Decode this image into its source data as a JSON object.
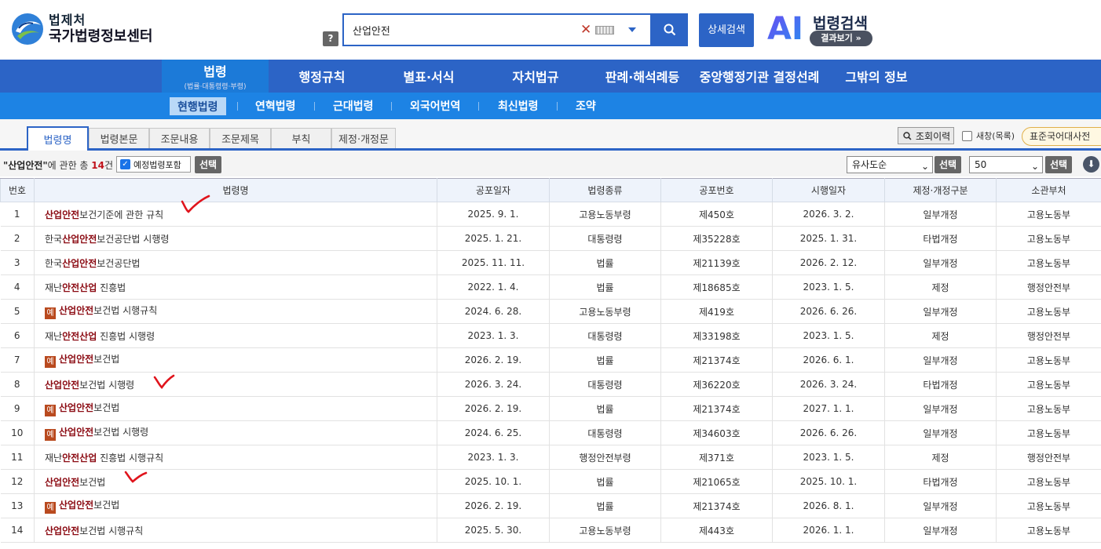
{
  "header": {
    "org": "법제처",
    "title": "국가법령정보센터",
    "help_label": "?",
    "search": {
      "value": "산업안전",
      "placeholder": ""
    },
    "advanced_search_label": "상세검색",
    "ai_label": "AI",
    "ai_title": "법령검색",
    "ai_result_label": "결과보기 »"
  },
  "nav_main": [
    {
      "label": "법령",
      "sub": "(법률·대통령령·부령)"
    },
    {
      "label": "행정규칙"
    },
    {
      "label": "별표·서식"
    },
    {
      "label": "자치법규"
    },
    {
      "label": "판례·해석례등"
    },
    {
      "label": "중앙행정기관 결정선례"
    },
    {
      "label": "그밖의 정보"
    }
  ],
  "nav_sub": [
    "현행법령",
    "연혁법령",
    "근대법령",
    "외국어번역",
    "최신법령",
    "조약"
  ],
  "tabs": [
    "법령명",
    "법령본문",
    "조문내용",
    "조문제목",
    "부칙",
    "제정·개정문"
  ],
  "tools": {
    "history_label": "조회이력",
    "new_window_label": "새창(목록)",
    "dictionary_label": "표준국어대사전"
  },
  "summary": {
    "query": "\"산업안전\"",
    "text_mid": "에 관한  총 ",
    "count": "14",
    "unit": "건",
    "include_label": "예정법령포함",
    "select_label": "선택",
    "sort_value": "유사도순",
    "page_size_value": "50"
  },
  "table": {
    "columns": [
      "번호",
      "법령명",
      "공포일자",
      "법령종류",
      "공포번호",
      "시행일자",
      "제정·개정구분",
      "소관부처"
    ],
    "rows": [
      {
        "no": "1",
        "badge": "",
        "pre": "",
        "kw": "산업안전",
        "post": "보건기준에 관한 규칙",
        "date": "2025. 9. 1.",
        "type": "고용노동부령",
        "pno": "제450호",
        "edate": "2026. 3. 2.",
        "rev": "일부개정",
        "dept": "고용노동부"
      },
      {
        "no": "2",
        "badge": "",
        "pre": "한국",
        "kw": "산업안전",
        "post": "보건공단법 시행령",
        "date": "2025. 1. 21.",
        "type": "대통령령",
        "pno": "제35228호",
        "edate": "2025. 1. 31.",
        "rev": "타법개정",
        "dept": "고용노동부"
      },
      {
        "no": "3",
        "badge": "",
        "pre": "한국",
        "kw": "산업안전",
        "post": "보건공단법",
        "date": "2025. 11. 11.",
        "type": "법률",
        "pno": "제21139호",
        "edate": "2026. 2. 12.",
        "rev": "일부개정",
        "dept": "고용노동부"
      },
      {
        "no": "4",
        "badge": "",
        "pre": "재난",
        "kw": "안전산업",
        "post": " 진흥법",
        "date": "2022. 1. 4.",
        "type": "법률",
        "pno": "제18685호",
        "edate": "2023. 1. 5.",
        "rev": "제정",
        "dept": "행정안전부"
      },
      {
        "no": "5",
        "badge": "예",
        "pre": "",
        "kw": "산업안전",
        "post": "보건법 시행규칙",
        "date": "2024. 6. 28.",
        "type": "고용노동부령",
        "pno": "제419호",
        "edate": "2026. 6. 26.",
        "rev": "일부개정",
        "dept": "고용노동부"
      },
      {
        "no": "6",
        "badge": "",
        "pre": "재난",
        "kw": "안전산업",
        "post": " 진흥법 시행령",
        "date": "2023. 1. 3.",
        "type": "대통령령",
        "pno": "제33198호",
        "edate": "2023. 1. 5.",
        "rev": "제정",
        "dept": "행정안전부"
      },
      {
        "no": "7",
        "badge": "예",
        "pre": "",
        "kw": "산업안전",
        "post": "보건법",
        "date": "2026. 2. 19.",
        "type": "법률",
        "pno": "제21374호",
        "edate": "2026. 6. 1.",
        "rev": "일부개정",
        "dept": "고용노동부"
      },
      {
        "no": "8",
        "badge": "",
        "pre": "",
        "kw": "산업안전",
        "post": "보건법 시행령",
        "date": "2026. 3. 24.",
        "type": "대통령령",
        "pno": "제36220호",
        "edate": "2026. 3. 24.",
        "rev": "타법개정",
        "dept": "고용노동부"
      },
      {
        "no": "9",
        "badge": "예",
        "pre": "",
        "kw": "산업안전",
        "post": "보건법",
        "date": "2026. 2. 19.",
        "type": "법률",
        "pno": "제21374호",
        "edate": "2027. 1. 1.",
        "rev": "일부개정",
        "dept": "고용노동부"
      },
      {
        "no": "10",
        "badge": "예",
        "pre": "",
        "kw": "산업안전",
        "post": "보건법 시행령",
        "date": "2024. 6. 25.",
        "type": "대통령령",
        "pno": "제34603호",
        "edate": "2026. 6. 26.",
        "rev": "일부개정",
        "dept": "고용노동부"
      },
      {
        "no": "11",
        "badge": "",
        "pre": "재난",
        "kw": "안전산업",
        "post": " 진흥법 시행규칙",
        "date": "2023. 1. 3.",
        "type": "행정안전부령",
        "pno": "제371호",
        "edate": "2023. 1. 5.",
        "rev": "제정",
        "dept": "행정안전부"
      },
      {
        "no": "12",
        "badge": "",
        "pre": "",
        "kw": "산업안전",
        "post": "보건법",
        "date": "2025. 10. 1.",
        "type": "법률",
        "pno": "제21065호",
        "edate": "2025. 10. 1.",
        "rev": "타법개정",
        "dept": "고용노동부"
      },
      {
        "no": "13",
        "badge": "예",
        "pre": "",
        "kw": "산업안전",
        "post": "보건법",
        "date": "2026. 2. 19.",
        "type": "법률",
        "pno": "제21374호",
        "edate": "2026. 8. 1.",
        "rev": "일부개정",
        "dept": "고용노동부"
      },
      {
        "no": "14",
        "badge": "",
        "pre": "",
        "kw": "산업안전",
        "post": "보건법 시행규칙",
        "date": "2025. 5. 30.",
        "type": "고용노동부령",
        "pno": "제443호",
        "edate": "2026. 1. 1.",
        "rev": "일부개정",
        "dept": "고용노동부"
      }
    ]
  },
  "colors": {
    "primary": "#2c64c6",
    "sub_nav": "#1d83e4",
    "keyword": "#8b0a12",
    "annotation": "#e0141c"
  }
}
